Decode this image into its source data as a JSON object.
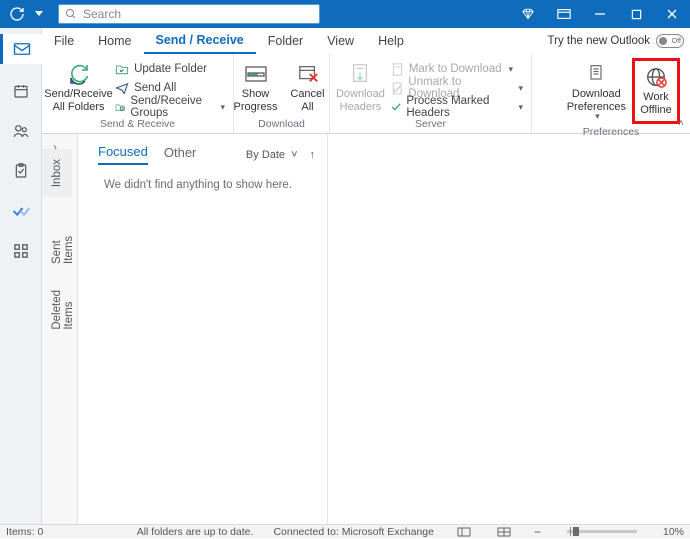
{
  "titlebar": {
    "search_placeholder": "Search"
  },
  "menu": {
    "file": "File",
    "home": "Home",
    "sendreceive": "Send / Receive",
    "folder": "Folder",
    "view": "View",
    "help": "Help",
    "trynew": "Try the new Outlook",
    "toggle_state": "Off"
  },
  "ribbon": {
    "group1": {
      "sendreceive_all": "Send/Receive\nAll Folders",
      "update_folder": "Update Folder",
      "send_all": "Send All",
      "sr_groups": "Send/Receive Groups",
      "label": "Send & Receive"
    },
    "group2": {
      "show_progress": "Show\nProgress",
      "cancel_all": "Cancel\nAll",
      "label": "Download"
    },
    "group3": {
      "download_headers": "Download\nHeaders",
      "mark_to_dl": "Mark to Download",
      "unmark_to_dl": "Unmark to Download",
      "process_marked": "Process Marked Headers",
      "label": "Server"
    },
    "group4": {
      "download_prefs": "Download\nPreferences",
      "work_offline": "Work\nOffline",
      "label": "Preferences"
    }
  },
  "nav": {
    "inbox": "Inbox",
    "sent": "Sent Items",
    "deleted": "Deleted Items"
  },
  "list": {
    "focused": "Focused",
    "other": "Other",
    "sort": "By Date",
    "empty": "We didn't find anything to show here."
  },
  "status": {
    "items": "Items: 0",
    "folders": "All folders are up to date.",
    "connected": "Connected to: Microsoft Exchange",
    "zoom": "10%"
  }
}
